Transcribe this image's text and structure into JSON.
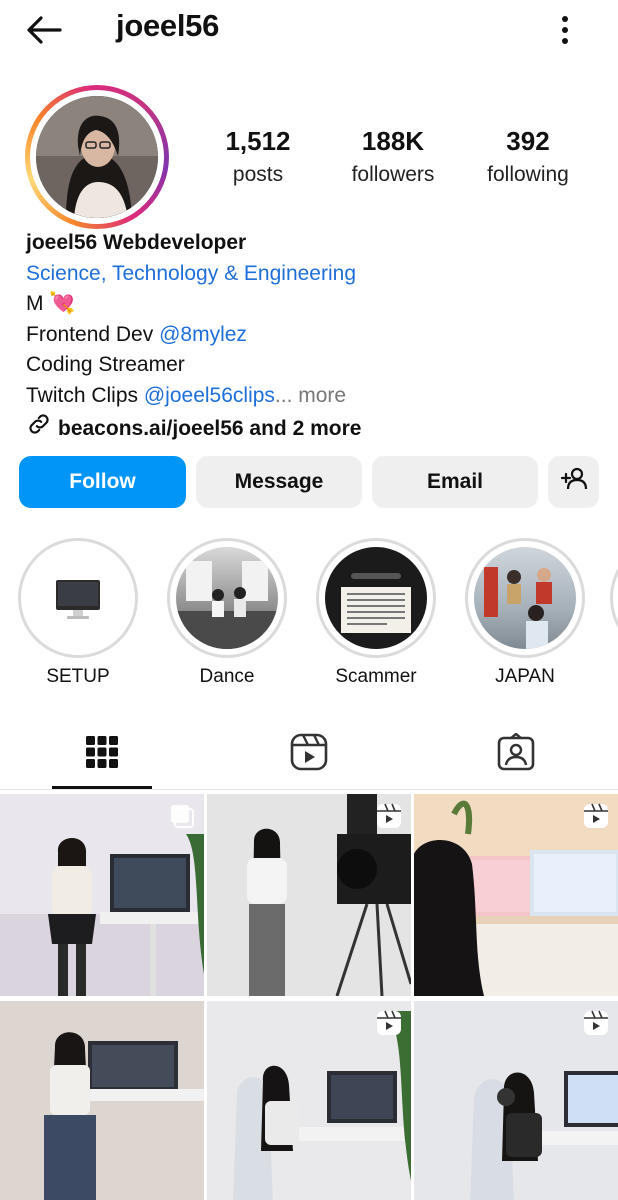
{
  "header": {
    "username": "joeel56"
  },
  "stats": [
    {
      "value": "1,512",
      "label": "posts"
    },
    {
      "value": "188K",
      "label": "followers"
    },
    {
      "value": "392",
      "label": "following"
    }
  ],
  "bio": {
    "name": "joeel56 Webdeveloper",
    "category": "Science, Technology & Engineering",
    "line1": "M 💘",
    "line2_prefix": "Frontend Dev ",
    "line2_mention": "@8mylez",
    "line3": "Coding Streamer",
    "line4_prefix": "Twitch Clips ",
    "line4_mention": "@joeel56clips",
    "line4_more": "... more",
    "link": "beacons.ai/joeel56 and 2 more"
  },
  "actions": {
    "follow": "Follow",
    "message": "Message",
    "email": "Email"
  },
  "highlights": [
    {
      "label": "SETUP"
    },
    {
      "label": "Dance"
    },
    {
      "label": "Scammer"
    },
    {
      "label": "JAPAN"
    }
  ],
  "colors": {
    "accent": "#0095f6",
    "link": "#1e6fd9"
  },
  "icons": [
    "back-arrow-icon",
    "more-options-icon",
    "link-icon",
    "add-person-icon",
    "grid-icon",
    "reels-icon",
    "tagged-icon",
    "reel-badge-icon",
    "multi-post-icon"
  ]
}
